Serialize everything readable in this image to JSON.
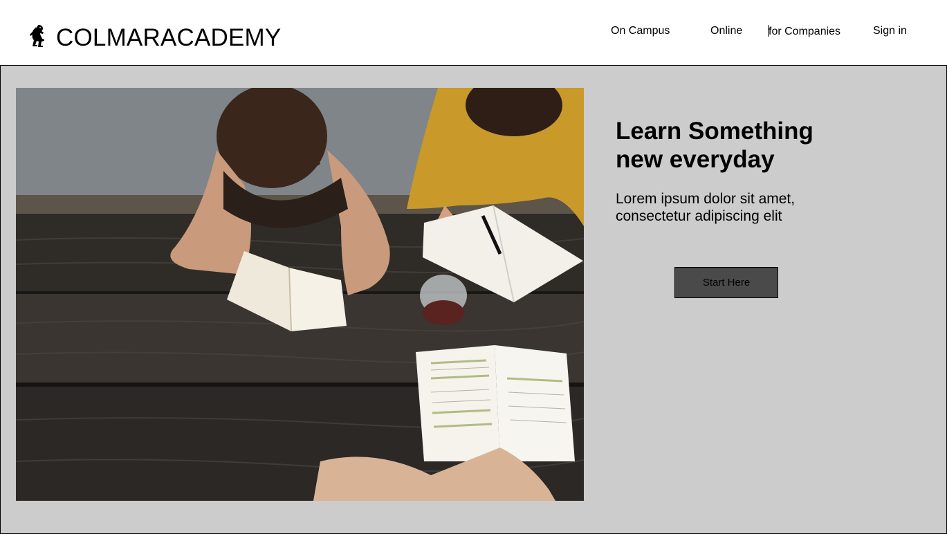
{
  "header": {
    "logo_icon": "rampant-lion-icon",
    "brand": "COLMARACADEMY",
    "nav": {
      "on_campus": "On Campus",
      "online": "Online",
      "for_companies": "for Companies",
      "sign_in": "Sign in"
    }
  },
  "hero": {
    "image": "students-studying-at-picnic-table",
    "headline_line1": "Learn Something",
    "headline_line2": "new everyday",
    "subtext_line1": "Lorem ipsum dolor sit amet,",
    "subtext_line2": "consectetur adipiscing elit",
    "cta_label": "Start Here",
    "background": "#cccccc",
    "cta_background": "#4a4a4a"
  }
}
